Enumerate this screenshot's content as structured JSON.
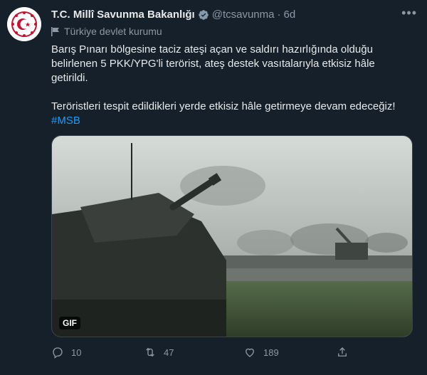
{
  "account": {
    "display_name": "T.C. Millî Savunma Bakanlığı",
    "handle": "@tcsavunma",
    "separator": "·",
    "time_ago": "6d",
    "affiliation_label": "Türkiye devlet kurumu",
    "more_icon": "more-icon"
  },
  "tweet": {
    "paragraph_1": "Barış Pınarı bölgesine taciz ateşi açan ve saldırı hazırlığında olduğu belirlenen 5 PKK/YPG'li terörist, ateş destek vasıtalarıyla etkisiz hâle getirildi.",
    "paragraph_2": "Teröristleri tespit edildikleri yerde etkisiz hâle getirmeye devam edeceğiz!",
    "hashtag": "#MSB"
  },
  "media": {
    "type": "GIF",
    "badge_label": "GIF",
    "description_icon": "howitzer-image"
  },
  "actions": {
    "reply_count": "10",
    "retweet_count": "47",
    "like_count": "189",
    "share_icon": "share-icon"
  },
  "colors": {
    "background": "#15202b",
    "text_primary": "#e7e9ea",
    "text_secondary": "#8b98a5",
    "accent": "#1d9bf0",
    "verified_badge": "#829aab"
  }
}
